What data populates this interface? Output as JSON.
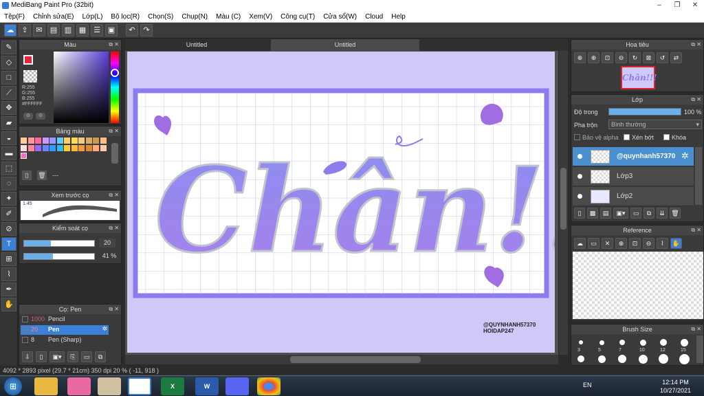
{
  "window": {
    "title": "MediBang Paint Pro (32bit)",
    "controls": [
      "–",
      "❐",
      "✕"
    ]
  },
  "menu": [
    "Tệp(F)",
    "Chỉnh sửa(E)",
    "Lớp(L)",
    "Bộ lọc(R)",
    "Chọn(S)",
    "Chụp(N)",
    "Màu (C)",
    "Xem(V)",
    "Công cụ(T)",
    "Cửa sổ(W)",
    "Cloud",
    "Help"
  ],
  "color_panel": {
    "title": "Màu",
    "r": "R:255",
    "g": "G:255",
    "b": "B:255",
    "hex": "#FFFFFF",
    "primary": "#e8233c",
    "hue_accent": "#5b3fd8"
  },
  "palette_panel": {
    "title": "Bảng màu",
    "footer": "---"
  },
  "brush_preview": {
    "title": "Xem trước cọ",
    "size_label": "1.45"
  },
  "brush_control": {
    "title": "Kiểm soát cọ",
    "size_value": "20",
    "opacity_value": "41 %",
    "size_fraction": 0.38,
    "opacity_fraction": 0.41
  },
  "brush_list": {
    "title": "Cọ: Pen",
    "items": [
      {
        "size": "1000",
        "name": "Pencil"
      },
      {
        "size": "20",
        "name": "Pen"
      },
      {
        "size": "8",
        "name": "Pen (Sharp)"
      }
    ]
  },
  "tabs": [
    "Untitled",
    "Untitled"
  ],
  "canvas": {
    "text": "Chân!!!",
    "watermark1": "@QUYNHANH57370",
    "watermark2": "HOIDAP247",
    "bg": "#cfc9f7",
    "accent": "#8b7df0"
  },
  "status": {
    "text": "4092 * 2893 pixel   (29.7 * 21cm)   350 dpi   20 %   ( -11, 918 )"
  },
  "navigator": {
    "title": "Hoa tiêu",
    "thumb_text": "Chân!!!"
  },
  "layers": {
    "title": "Lớp",
    "opacity_label": "Độ trong",
    "opacity_value": "100 %",
    "opacity_fraction": 1.0,
    "blend_label": "Pha trộn",
    "blend_value": "Bình thường",
    "protect_alpha": "Bảo vệ alpha",
    "clipping": "Xén bớt",
    "lock": "Khóa",
    "items": [
      {
        "name": "@quynhanh57370"
      },
      {
        "name": "Lớp3"
      },
      {
        "name": "Lớp2"
      }
    ]
  },
  "reference": {
    "title": "Reference"
  },
  "brush_size": {
    "title": "Brush Size",
    "labels": [
      "3",
      "5",
      "7",
      "10",
      "12",
      "15"
    ]
  },
  "taskbar": {
    "lang": "EN",
    "time": "12:14 PM",
    "date": "10/27/2021"
  }
}
